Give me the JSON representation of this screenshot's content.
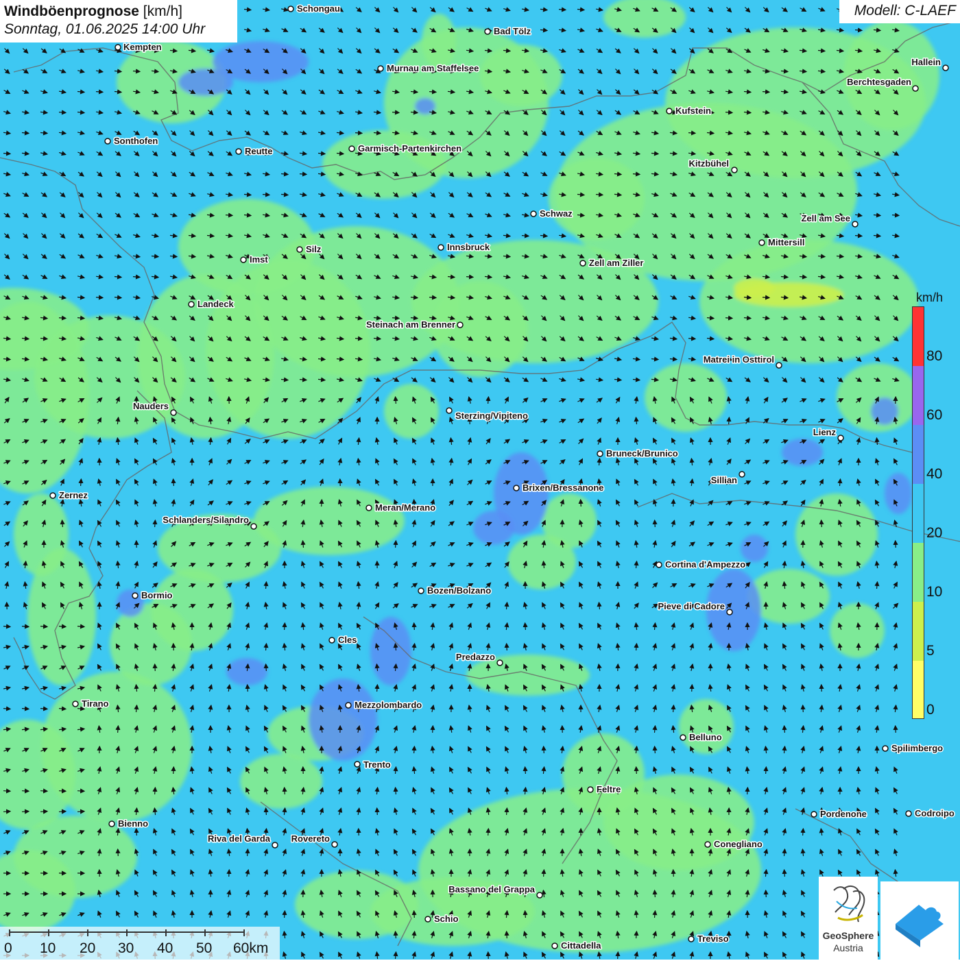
{
  "title": {
    "main": "Windböenprognose",
    "unit": " [km/h]",
    "datetime": "Sonntag, 01.06.2025 14:00 Uhr"
  },
  "model": "Modell: C-LAEF",
  "legend": {
    "unit": "km/h",
    "ticks": [
      "80",
      "60",
      "40",
      "20",
      "10",
      "5",
      "0"
    ],
    "colors": {
      "0-5": "#ffff66",
      "5-10": "#ccf04c",
      "10-20": "#88ee88",
      "20-40": "#3ec8f2",
      "40-60": "#5b8ef5",
      "60-80": "#9966ee",
      "80+": "#ff3333"
    }
  },
  "scale_bar": {
    "labels": [
      "0",
      "10",
      "20",
      "30",
      "40",
      "50",
      "60km"
    ]
  },
  "logos": {
    "geosphere_line1": "GeoSphere",
    "geosphere_line2": "Austria"
  },
  "cities": [
    "Schongau",
    "Kempten",
    "Bad Tölz",
    "Murnau am Staffelsee",
    "Hallein",
    "Berchtesgaden",
    "Kufstein",
    "Sonthofen",
    "Reutte",
    "Garmisch-Partenkirchen",
    "Kitzbühel",
    "Schwaz",
    "Zell am See",
    "Mittersill",
    "Innsbruck",
    "Silz",
    "Imst",
    "Zell am Ziller",
    "Landeck",
    "Steinach am Brenner",
    "Matrei in Osttirol",
    "Nauders",
    "Sterzing/Vipiteno",
    "Lienz",
    "Bruneck/Brunico",
    "Sillian",
    "Zernez",
    "Brixen/Bressanone",
    "Meran/Merano",
    "Schlanders/Silandro",
    "Cortina d'Ampezzo",
    "Bozen/Bolzano",
    "Bormio",
    "Pieve di Cadore",
    "Cles",
    "Predazzo",
    "Tirano",
    "Mezzolombardo",
    "Belluno",
    "Spilimbergo",
    "Trento",
    "Feltre",
    "Pordenone",
    "Codroipo",
    "Bienno",
    "Riva del Garda",
    "Rovereto",
    "Conegliano",
    "Bassano del Grappa",
    "Schio",
    "Treviso",
    "Cittadella"
  ]
}
